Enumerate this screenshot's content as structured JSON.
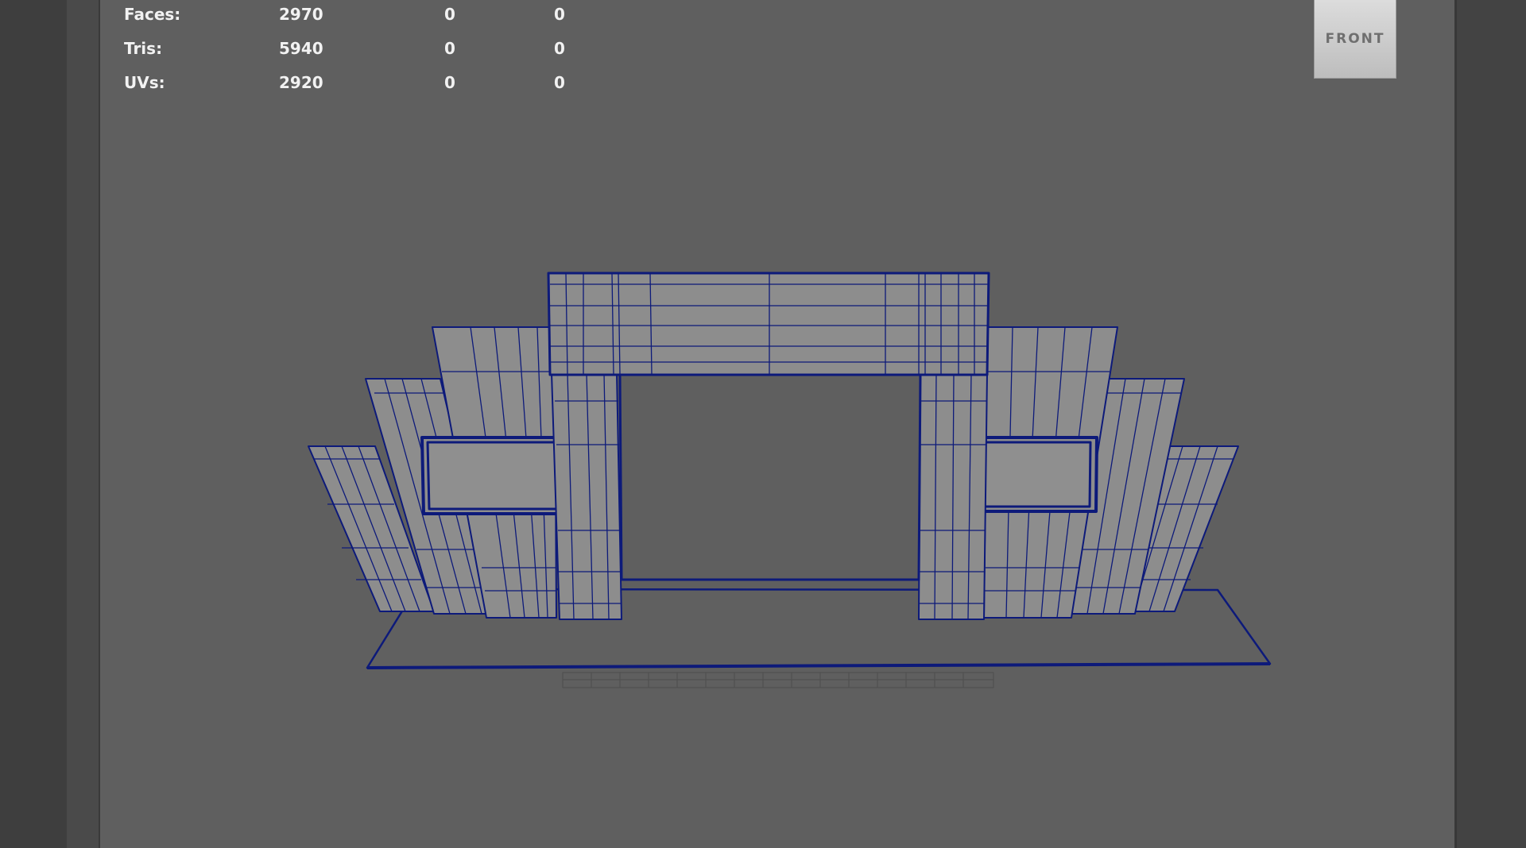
{
  "hud": {
    "rows": [
      {
        "label": "Faces:",
        "v1": "2970",
        "v2": "0",
        "v3": "0"
      },
      {
        "label": "Tris:",
        "v1": "5940",
        "v2": "0",
        "v3": "0"
      },
      {
        "label": "UVs:",
        "v1": "2920",
        "v2": "0",
        "v3": "0"
      }
    ]
  },
  "view_cube": {
    "label": "FRONT"
  },
  "colors": {
    "wire": "#0d1a7a",
    "face": "#8d8d8d",
    "viewport_bg": "#5f5f5f"
  },
  "icons": {
    "view_cube": "view-cube-icon"
  }
}
